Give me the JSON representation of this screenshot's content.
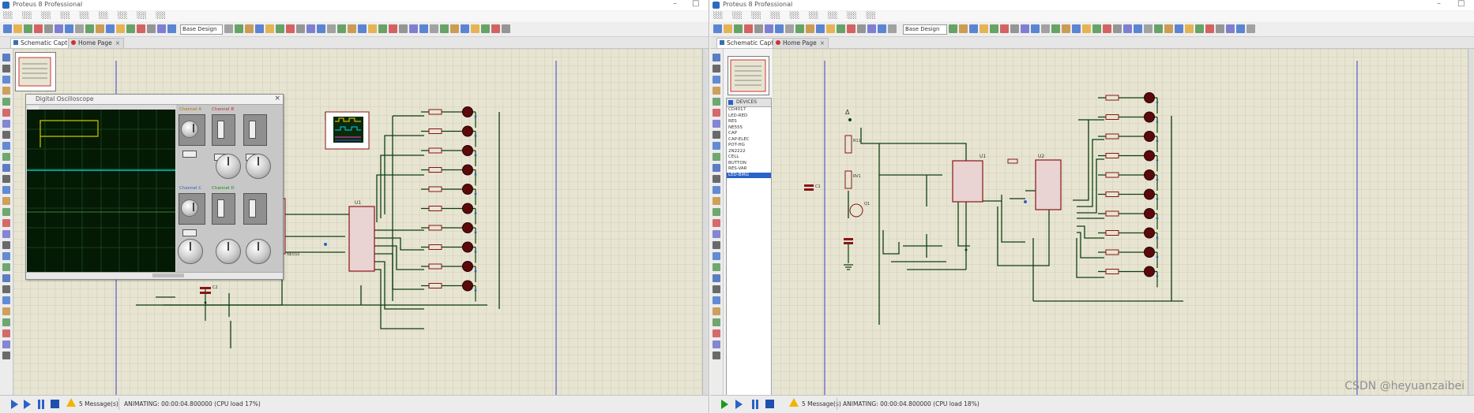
{
  "left_window": {
    "title": "Proteus 8 Professional",
    "tabs": [
      {
        "label": "Schematic Capture",
        "close": "×"
      },
      {
        "label": "Home Page",
        "close": "×"
      }
    ],
    "design_dropdown": "Base Design",
    "oscilloscope_title": "Digital Oscilloscope",
    "osc_close": "×",
    "channel_labels": [
      "Channel A",
      "Channel B",
      "Channel C",
      "Channel D"
    ],
    "status_text": "5 Message(s)",
    "status_info": "ANIMATING: 00:00:04.800000 (CPU load 17%)"
  },
  "right_window": {
    "title": "Proteus 8 Professional",
    "tabs": [
      {
        "label": "Schematic Capture",
        "close": "×"
      },
      {
        "label": "Home Page",
        "close": "×"
      }
    ],
    "design_dropdown": "Base Design",
    "device_list_header": "DEVICES",
    "devices": [
      "CD4017",
      "LED-RED",
      "RES",
      "NE555",
      "CAP",
      "CAP-ELEC",
      "POT-HG",
      "2N2222",
      "CELL",
      "BUTTON",
      "RES-VAR",
      "LED-BIRG"
    ],
    "selected_device_index": 11,
    "status_text": "5 Message(s)",
    "status_info": "ANIMATING: 00:00:04.800000 (CPU load 18%)"
  },
  "watermark": "CSDN @heyuanzaibei",
  "colors": {
    "canvas": "#e7e5d2",
    "wire": "#0f3f0f",
    "led": "#5a0a0a",
    "ic_fill": "#e9d3d3",
    "ic_border": "#8a1515",
    "osc_trace_a": "#c8c800",
    "osc_trace_b": "#00c8c8",
    "accent": "#2a62c9"
  }
}
